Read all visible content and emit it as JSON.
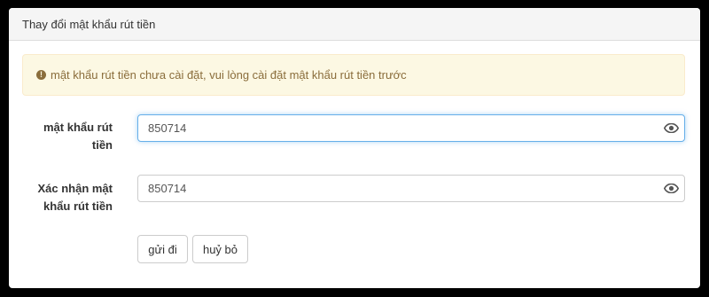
{
  "panel": {
    "title": "Thay đổi mật khẩu rút tiền"
  },
  "alert": {
    "icon": "exclamation-circle-icon",
    "message": "mật khẩu rút tiền chưa cài đặt, vui lòng cài đặt mật khẩu rút tiền trước"
  },
  "form": {
    "password": {
      "label_line1": "mật khẩu rút",
      "label_line2": "tiền",
      "value": "850714",
      "icon": "eye-icon"
    },
    "confirm": {
      "label_line1": "Xác nhận mật",
      "label_line2": "khẩu rút tiền",
      "value": "850714",
      "icon": "eye-icon"
    }
  },
  "buttons": {
    "submit": "gửi đi",
    "cancel": "huỷ bỏ"
  },
  "colors": {
    "alert_bg": "#fcf8e3",
    "alert_text": "#8a6d3b",
    "focus_border": "#66afe9"
  }
}
